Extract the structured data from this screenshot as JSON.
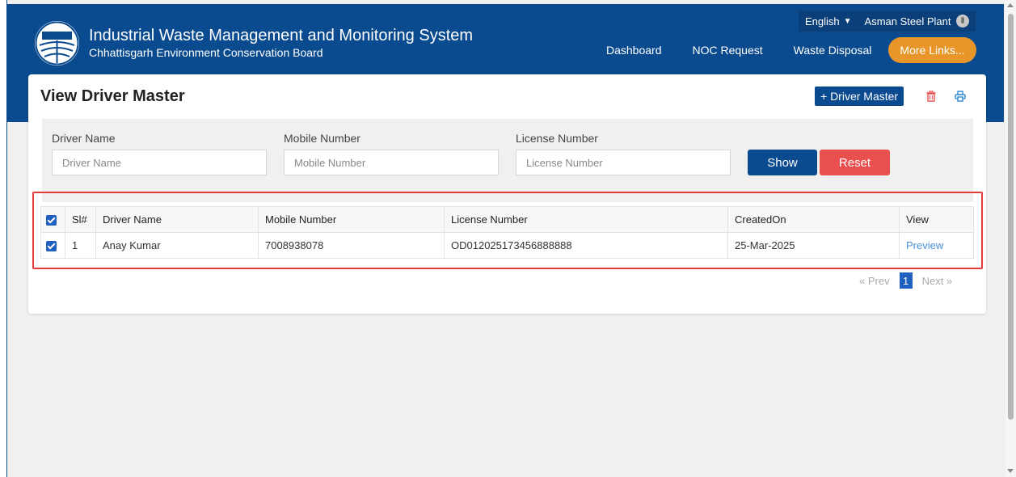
{
  "header": {
    "title": "Industrial Waste Management and Monitoring System",
    "subtitle": "Chhattisgarh Environment Conservation Board",
    "language": "English",
    "plant": "Asman Steel Plant",
    "nav": [
      "Dashboard",
      "NOC Request",
      "Waste Disposal"
    ],
    "more_links": "More Links..."
  },
  "page": {
    "title": "View Driver Master",
    "add_button": "+ Driver Master"
  },
  "filters": {
    "driver_name": {
      "label": "Driver Name",
      "placeholder": "Driver Name"
    },
    "mobile_number": {
      "label": "Mobile Number",
      "placeholder": "Mobile Number"
    },
    "license_number": {
      "label": "License Number",
      "placeholder": "License Number"
    },
    "show": "Show",
    "reset": "Reset"
  },
  "table": {
    "columns": [
      "Sl#",
      "Driver Name",
      "Mobile Number",
      "License Number",
      "CreatedOn",
      "View"
    ],
    "rows": [
      {
        "sl": "1",
        "driver_name": "Anay Kumar",
        "mobile_number": "7008938078",
        "license_number": "OD012025173456888888",
        "created_on": "25-Mar-2025",
        "view": "Preview"
      }
    ]
  },
  "pager": {
    "prev": "« Prev",
    "current": "1",
    "next": "Next »"
  },
  "colors": {
    "brand_blue": "#0a4a8f",
    "accent_orange": "#e8962a",
    "danger_red": "#e94f4f",
    "highlight_red": "#e23c3c"
  }
}
